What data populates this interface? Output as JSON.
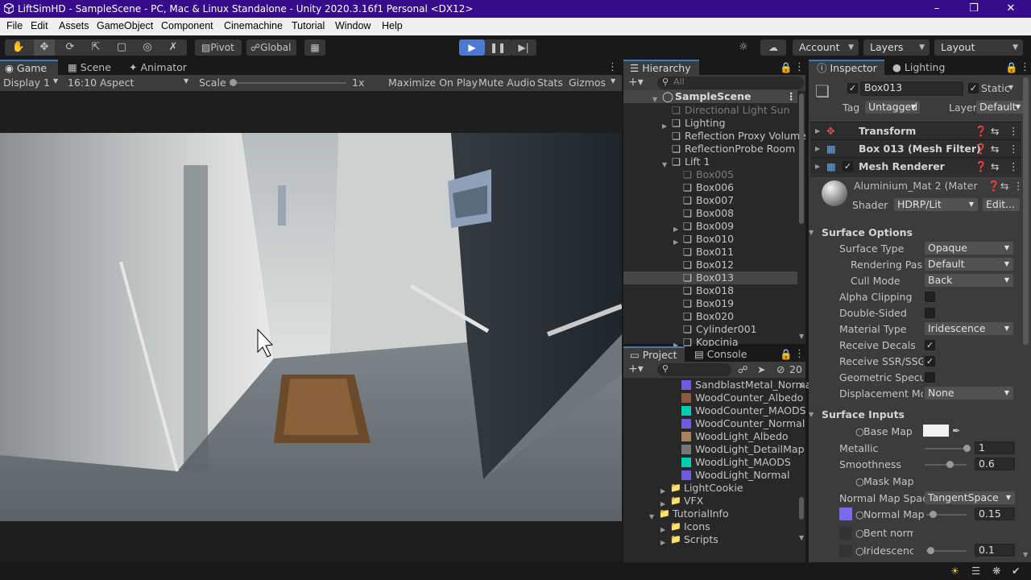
{
  "window": {
    "title": "LiftSimHD - SampleScene - PC, Mac & Linux Standalone - Unity 2020.3.16f1 Personal <DX12>"
  },
  "menu": [
    "File",
    "Edit",
    "Assets",
    "GameObject",
    "Component",
    "Cinemachine",
    "Tutorial",
    "Window",
    "Help"
  ],
  "toolbar": {
    "pivot": "Pivot",
    "global": "Global",
    "account": "Account",
    "layers": "Layers",
    "layout": "Layout"
  },
  "game": {
    "tabs": [
      "Game",
      "Scene",
      "Animator"
    ],
    "display": "Display 1",
    "aspect": "16:10 Aspect",
    "scale_label": "Scale",
    "scale_value": "1x",
    "maximize": "Maximize On Play",
    "mute": "Mute Audio",
    "stats": "Stats",
    "gizmos": "Gizmos"
  },
  "hierarchy": {
    "tab": "Hierarchy",
    "search_placeholder": "All",
    "scene": "SampleScene",
    "items": [
      {
        "label": "Directional Light Sun",
        "dim": true
      },
      {
        "label": "Lighting",
        "dim": false
      },
      {
        "label": "Reflection Proxy Volume",
        "dim": false
      },
      {
        "label": "ReflectionProbe Room 1",
        "dim": false
      },
      {
        "label": "Lift 1",
        "dim": false
      },
      {
        "label": "Box005",
        "dim": true
      },
      {
        "label": "Box006",
        "dim": false
      },
      {
        "label": "Box007",
        "dim": false
      },
      {
        "label": "Box008",
        "dim": false
      },
      {
        "label": "Box009",
        "dim": false
      },
      {
        "label": "Box010",
        "dim": false
      },
      {
        "label": "Box011",
        "dim": false
      },
      {
        "label": "Box012",
        "dim": false
      },
      {
        "label": "Box013",
        "dim": false
      },
      {
        "label": "Box018",
        "dim": false
      },
      {
        "label": "Box019",
        "dim": false
      },
      {
        "label": "Box020",
        "dim": false
      },
      {
        "label": "Cylinder001",
        "dim": false
      },
      {
        "label": "Kopcinia",
        "dim": false
      }
    ]
  },
  "project": {
    "tabs": [
      "Project",
      "Console"
    ],
    "hidden_count": "20",
    "files": [
      {
        "label": "SandblastMetal_Norma",
        "color": "#6f5ae0"
      },
      {
        "label": "WoodCounter_Albedo",
        "color": "#8a5a3c"
      },
      {
        "label": "WoodCounter_MAODS",
        "color": "#00cdb0"
      },
      {
        "label": "WoodCounter_Normal",
        "color": "#6f5ae0"
      },
      {
        "label": "WoodLight_Albedo",
        "color": "#a8825e"
      },
      {
        "label": "WoodLight_DetailMap",
        "color": "#777777"
      },
      {
        "label": "WoodLight_MAODS",
        "color": "#00cdb0"
      },
      {
        "label": "WoodLight_Normal",
        "color": "#6f5ae0"
      }
    ],
    "folders": [
      {
        "label": "LightCookie",
        "open": false
      },
      {
        "label": "VFX",
        "open": false
      },
      {
        "label": "TutorialInfo",
        "open": true
      },
      {
        "label": "Icons",
        "open": false
      },
      {
        "label": "Scripts",
        "open": false
      }
    ]
  },
  "inspector": {
    "tabs": [
      "Inspector",
      "Lighting"
    ],
    "object_name": "Box013",
    "static": "Static",
    "tag_label": "Tag",
    "tag": "Untagged",
    "layer_label": "Layer",
    "layer": "Default",
    "components": [
      "Transform",
      "Box 013 (Mesh Filter)",
      "Mesh Renderer"
    ],
    "material": "Aluminium_Mat 2 (Mater",
    "shader_label": "Shader",
    "shader": "HDRP/Lit",
    "edit": "Edit...",
    "surface_options": "Surface Options",
    "props": [
      {
        "label": "Surface Type",
        "value": "Opaque"
      },
      {
        "label": "Rendering Pass",
        "value": "Default"
      },
      {
        "label": "Cull Mode",
        "value": "Back"
      },
      {
        "label": "Alpha Clipping",
        "value": ""
      },
      {
        "label": "Double-Sided",
        "value": ""
      },
      {
        "label": "Material Type",
        "value": "Iridescence"
      },
      {
        "label": "Receive Decals",
        "value": "✓"
      },
      {
        "label": "Receive SSR/SSGI",
        "value": "✓"
      },
      {
        "label": "Geometric Specula",
        "value": ""
      },
      {
        "label": "Displacement Mod",
        "value": "None"
      }
    ],
    "surface_inputs": "Surface Inputs",
    "inputs": {
      "base_map": "Base Map",
      "metallic": "Metallic",
      "metallic_value": "1",
      "smoothness": "Smoothness",
      "smoothness_value": "0.6",
      "mask_map": "Mask Map",
      "normal_space_label": "Normal Map Space",
      "normal_space": "TangentSpace",
      "normal_map": "Normal Map",
      "normal_value": "0.15",
      "bent_normal": "Bent normal ma",
      "iridescence": "Iridescence Ma",
      "iridescence_value": "0.1"
    },
    "metallic_level": 1,
    "smoothness_level": 0.6,
    "normal_level": 0.15,
    "iridescence_level": 0.1
  },
  "colors": {
    "title_bar": "#360c8c",
    "accent": "#3a79bb",
    "play_active": "#4b7bd0"
  }
}
